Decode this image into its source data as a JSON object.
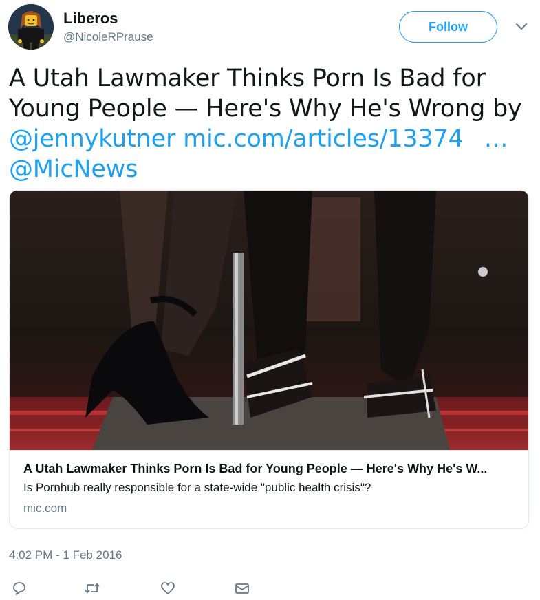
{
  "user": {
    "display_name": "Liberos",
    "handle": "@NicoleRPrause",
    "avatar_icon": "lego-figure-avatar"
  },
  "follow_label": "Follow",
  "tweet": {
    "line1": "A Utah Lawmaker Thinks Porn Is Bad for",
    "line2": "Young People — Here's Why He's Wrong by",
    "mention1": "@jennykutner",
    "link": "mic.com/articles/13374",
    "ellipsis": "…",
    "mention2": "@MicNews"
  },
  "card": {
    "title": "A Utah Lawmaker Thinks Porn Is Bad for Young People — Here's Why He's W...",
    "description": "Is Pornhub really responsible for a state-wide \"public health crisis\"?",
    "domain": "mic.com"
  },
  "timestamp": "4:02 PM - 1 Feb 2016",
  "actions": {
    "reply_icon": "reply-icon",
    "retweet_icon": "retweet-icon",
    "like_icon": "heart-icon",
    "dm_icon": "envelope-icon"
  },
  "colors": {
    "accent": "#1da1f2",
    "secondary_text": "#657786",
    "border": "#e1e8ed"
  }
}
